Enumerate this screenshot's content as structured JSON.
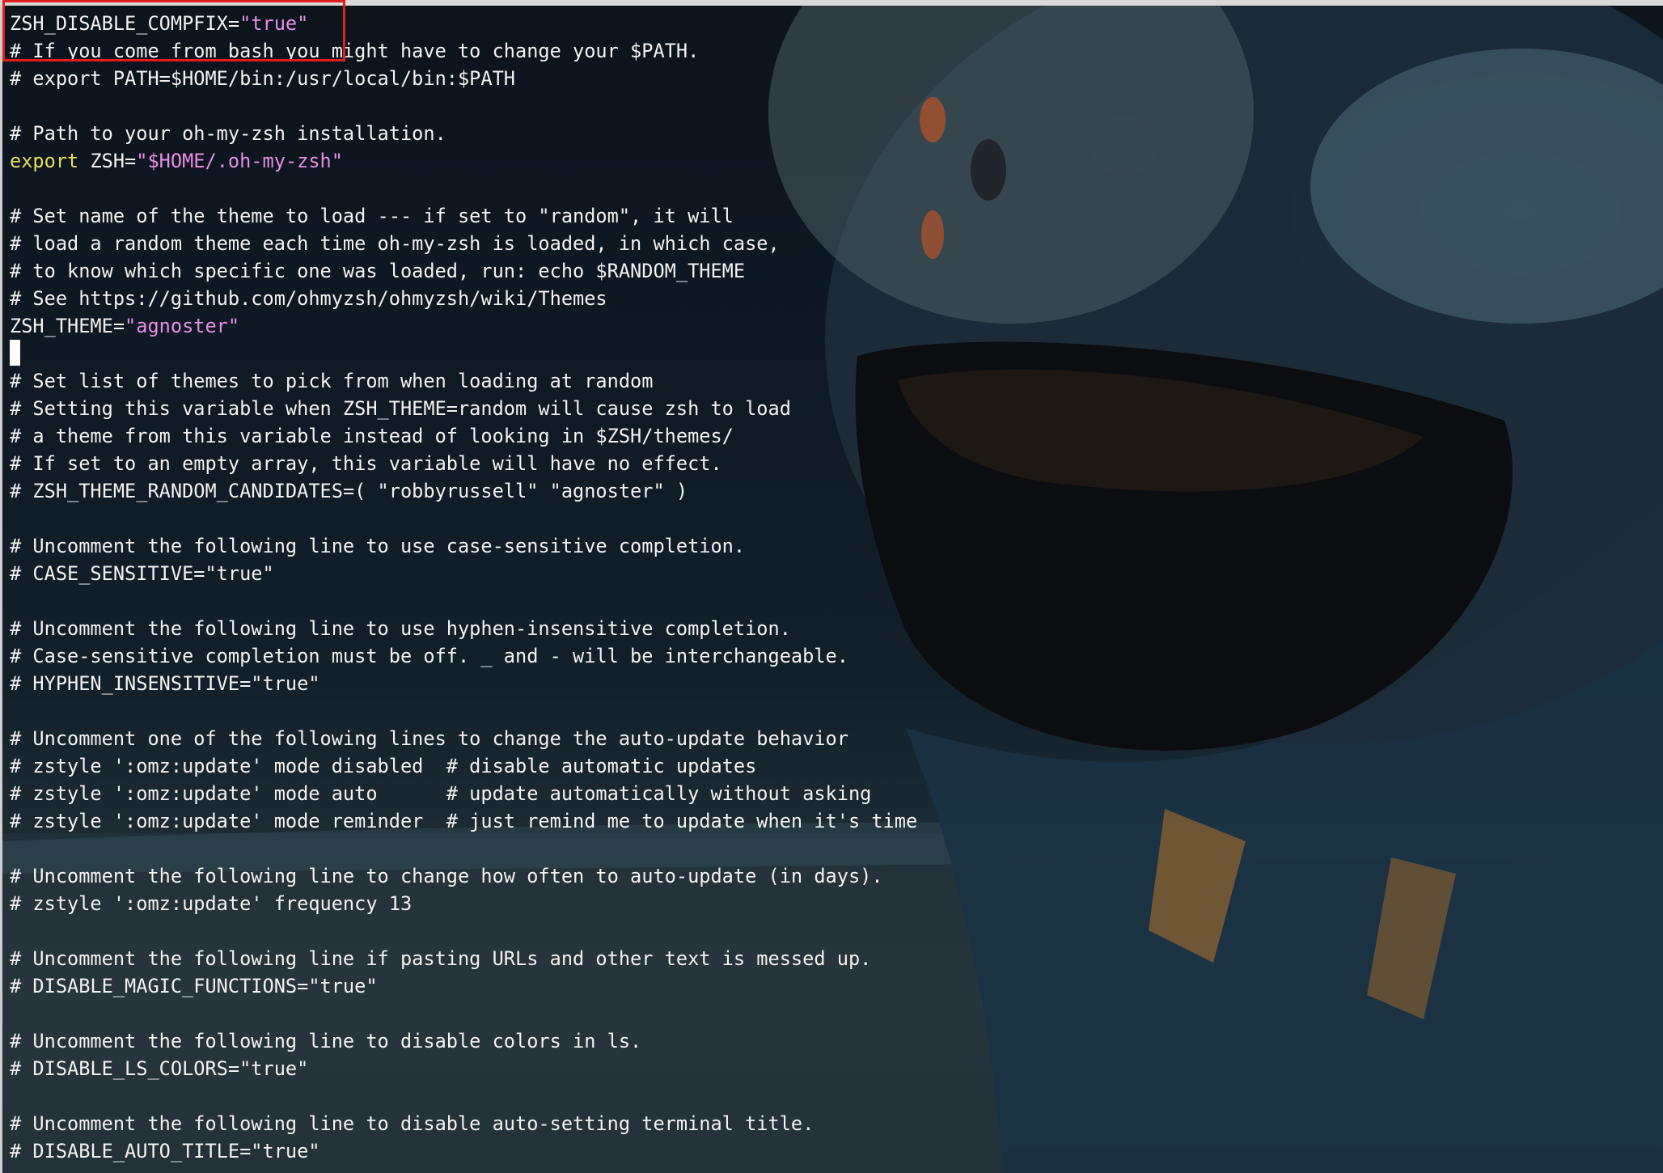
{
  "colors": {
    "text": "#f2f2f2",
    "keyword": "#e6dd5a",
    "string": "#e88ee2",
    "highlight_box": "#e01e1e",
    "background": "#0f1a24"
  },
  "editor": {
    "lines": [
      {
        "parts": [
          {
            "t": "ZSH_DISABLE_COMPFIX="
          },
          {
            "t": "\"true\"",
            "c": "s"
          }
        ]
      },
      {
        "parts": [
          {
            "t": "# If you come from bash you might have to change your $PATH."
          }
        ]
      },
      {
        "parts": [
          {
            "t": "# export PATH=$HOME/bin:/usr/local/bin:$PATH"
          }
        ]
      },
      {
        "parts": []
      },
      {
        "parts": [
          {
            "t": "# Path to your oh-my-zsh installation."
          }
        ]
      },
      {
        "parts": [
          {
            "t": "export",
            "c": "k"
          },
          {
            "t": " ZSH="
          },
          {
            "t": "\"$HOME/.oh-my-zsh\"",
            "c": "s"
          }
        ]
      },
      {
        "parts": []
      },
      {
        "parts": [
          {
            "t": "# Set name of the theme to load --- if set to \"random\", it will"
          }
        ]
      },
      {
        "parts": [
          {
            "t": "# load a random theme each time oh-my-zsh is loaded, in which case,"
          }
        ]
      },
      {
        "parts": [
          {
            "t": "# to know which specific one was loaded, run: echo $RANDOM_THEME"
          }
        ]
      },
      {
        "parts": [
          {
            "t": "# See https://github.com/ohmyzsh/ohmyzsh/wiki/Themes"
          }
        ]
      },
      {
        "parts": [
          {
            "t": "ZSH_THEME="
          },
          {
            "t": "\"agnoster\"",
            "c": "s"
          }
        ]
      },
      {
        "cursor": true,
        "parts": []
      },
      {
        "parts": [
          {
            "t": "# Set list of themes to pick from when loading at random"
          }
        ]
      },
      {
        "parts": [
          {
            "t": "# Setting this variable when ZSH_THEME=random will cause zsh to load"
          }
        ]
      },
      {
        "parts": [
          {
            "t": "# a theme from this variable instead of looking in $ZSH/themes/"
          }
        ]
      },
      {
        "parts": [
          {
            "t": "# If set to an empty array, this variable will have no effect."
          }
        ]
      },
      {
        "parts": [
          {
            "t": "# ZSH_THEME_RANDOM_CANDIDATES=( \"robbyrussell\" \"agnoster\" )"
          }
        ]
      },
      {
        "parts": []
      },
      {
        "parts": [
          {
            "t": "# Uncomment the following line to use case-sensitive completion."
          }
        ]
      },
      {
        "parts": [
          {
            "t": "# CASE_SENSITIVE=\"true\""
          }
        ]
      },
      {
        "parts": []
      },
      {
        "parts": [
          {
            "t": "# Uncomment the following line to use hyphen-insensitive completion."
          }
        ]
      },
      {
        "parts": [
          {
            "t": "# Case-sensitive completion must be off. _ and - will be interchangeable."
          }
        ]
      },
      {
        "parts": [
          {
            "t": "# HYPHEN_INSENSITIVE=\"true\""
          }
        ]
      },
      {
        "parts": []
      },
      {
        "parts": [
          {
            "t": "# Uncomment one of the following lines to change the auto-update behavior"
          }
        ]
      },
      {
        "parts": [
          {
            "t": "# zstyle ':omz:update' mode disabled  # disable automatic updates"
          }
        ]
      },
      {
        "parts": [
          {
            "t": "# zstyle ':omz:update' mode auto      # update automatically without asking"
          }
        ]
      },
      {
        "parts": [
          {
            "t": "# zstyle ':omz:update' mode reminder  # just remind me to update when it's time"
          }
        ]
      },
      {
        "parts": []
      },
      {
        "parts": [
          {
            "t": "# Uncomment the following line to change how often to auto-update (in days)."
          }
        ]
      },
      {
        "parts": [
          {
            "t": "# zstyle ':omz:update' frequency 13"
          }
        ]
      },
      {
        "parts": []
      },
      {
        "parts": [
          {
            "t": "# Uncomment the following line if pasting URLs and other text is messed up."
          }
        ]
      },
      {
        "parts": [
          {
            "t": "# DISABLE_MAGIC_FUNCTIONS=\"true\""
          }
        ]
      },
      {
        "parts": []
      },
      {
        "parts": [
          {
            "t": "# Uncomment the following line to disable colors in ls."
          }
        ]
      },
      {
        "parts": [
          {
            "t": "# DISABLE_LS_COLORS=\"true\""
          }
        ]
      },
      {
        "parts": []
      },
      {
        "parts": [
          {
            "t": "# Uncomment the following line to disable auto-setting terminal title."
          }
        ]
      },
      {
        "parts": [
          {
            "t": "# DISABLE_AUTO_TITLE=\"true\""
          }
        ]
      }
    ]
  }
}
